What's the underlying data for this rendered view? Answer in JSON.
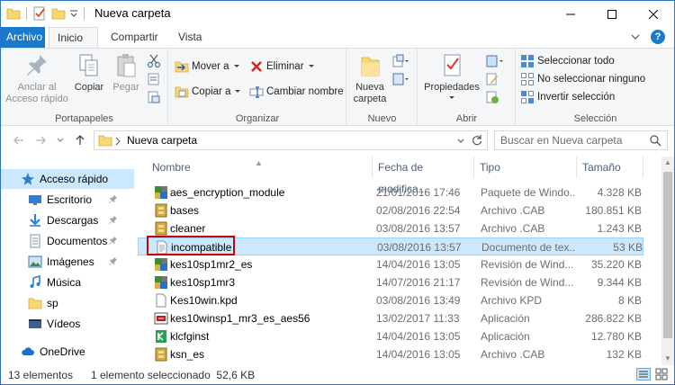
{
  "window": {
    "title": "Nueva carpeta",
    "colors": {
      "accent": "#1979ca",
      "selection": "#cce8ff",
      "highlight": "#cc0000"
    }
  },
  "ribbon_tabs": [
    "Archivo",
    "Inicio",
    "Compartir",
    "Vista"
  ],
  "ribbon": {
    "portapapeles": {
      "label": "Portapapeles",
      "pin": "Anclar al Acceso rápido",
      "copy": "Copiar",
      "paste": "Pegar"
    },
    "organizar": {
      "label": "Organizar",
      "move_to": "Mover a",
      "copy_to": "Copiar a",
      "delete": "Eliminar",
      "rename": "Cambiar nombre"
    },
    "nuevo": {
      "label": "Nuevo",
      "new_folder": "Nueva carpeta"
    },
    "abrir": {
      "label": "Abrir",
      "properties": "Propiedades"
    },
    "seleccionar": {
      "label": "Selección",
      "select_all": "Seleccionar todo",
      "select_none": "No seleccionar ninguno",
      "invert": "Invertir selección"
    }
  },
  "address": {
    "breadcrumb": "Nueva carpeta",
    "search_placeholder": "Buscar en Nueva carpeta"
  },
  "nav_pane": [
    {
      "label": "Acceso rápido",
      "icon": "star-icon",
      "selected": true,
      "pinned": false
    },
    {
      "label": "Escritorio",
      "icon": "desktop-icon",
      "selected": false,
      "pinned": true
    },
    {
      "label": "Descargas",
      "icon": "download-icon",
      "selected": false,
      "pinned": true
    },
    {
      "label": "Documentos",
      "icon": "documents-icon",
      "selected": false,
      "pinned": true
    },
    {
      "label": "Imágenes",
      "icon": "images-icon",
      "selected": false,
      "pinned": true
    },
    {
      "label": "Música",
      "icon": "music-icon",
      "selected": false,
      "pinned": false
    },
    {
      "label": "sp",
      "icon": "folder-icon",
      "selected": false,
      "pinned": false
    },
    {
      "label": "Vídeos",
      "icon": "videos-icon",
      "selected": false,
      "pinned": false
    },
    {
      "label": "OneDrive",
      "icon": "onedrive-icon",
      "selected": false,
      "pinned": false
    }
  ],
  "columns": [
    "Nombre",
    "Fecha de modifica...",
    "Tipo",
    "Tamaño"
  ],
  "files": [
    {
      "name": "aes_encryption_module",
      "date": "21/01/2016 17:46",
      "type": "Paquete de Windo...",
      "size": "4.328 KB",
      "icon": "package-icon",
      "selected": false
    },
    {
      "name": "bases",
      "date": "02/08/2016 22:54",
      "type": "Archivo .CAB",
      "size": "180.851 KB",
      "icon": "cab-icon",
      "selected": false
    },
    {
      "name": "cleaner",
      "date": "03/08/2016 13:57",
      "type": "Archivo .CAB",
      "size": "1.243 KB",
      "icon": "cab-icon",
      "selected": false
    },
    {
      "name": "incompatible",
      "date": "03/08/2016 13:57",
      "type": "Documento de tex...",
      "size": "53 KB",
      "icon": "text-file-icon",
      "selected": true
    },
    {
      "name": "kes10sp1mr2_es",
      "date": "14/04/2016 13:05",
      "type": "Revisión de Wind...",
      "size": "35.220 KB",
      "icon": "package-icon",
      "selected": false
    },
    {
      "name": "kes10sp1mr3",
      "date": "14/07/2016 21:17",
      "type": "Revisión de Wind...",
      "size": "9.344 KB",
      "icon": "package-icon",
      "selected": false
    },
    {
      "name": "Kes10win.kpd",
      "date": "03/08/2016 13:49",
      "type": "Archivo KPD",
      "size": "8 KB",
      "icon": "blank-file-icon",
      "selected": false
    },
    {
      "name": "kes10winsp1_mr3_es_aes56",
      "date": "13/02/2017 11:33",
      "type": "Aplicación",
      "size": "286.822 KB",
      "icon": "app-icon",
      "selected": false
    },
    {
      "name": "klcfginst",
      "date": "14/04/2016 13:05",
      "type": "Aplicación",
      "size": "12.780 KB",
      "icon": "kl-app-icon",
      "selected": false
    },
    {
      "name": "ksn_es",
      "date": "14/04/2016 13:05",
      "type": "Archivo .CAB",
      "size": "132 KB",
      "icon": "cab-icon",
      "selected": false
    }
  ],
  "status": {
    "count": "13 elementos",
    "selection": "1 elemento seleccionado  52,6 KB"
  }
}
